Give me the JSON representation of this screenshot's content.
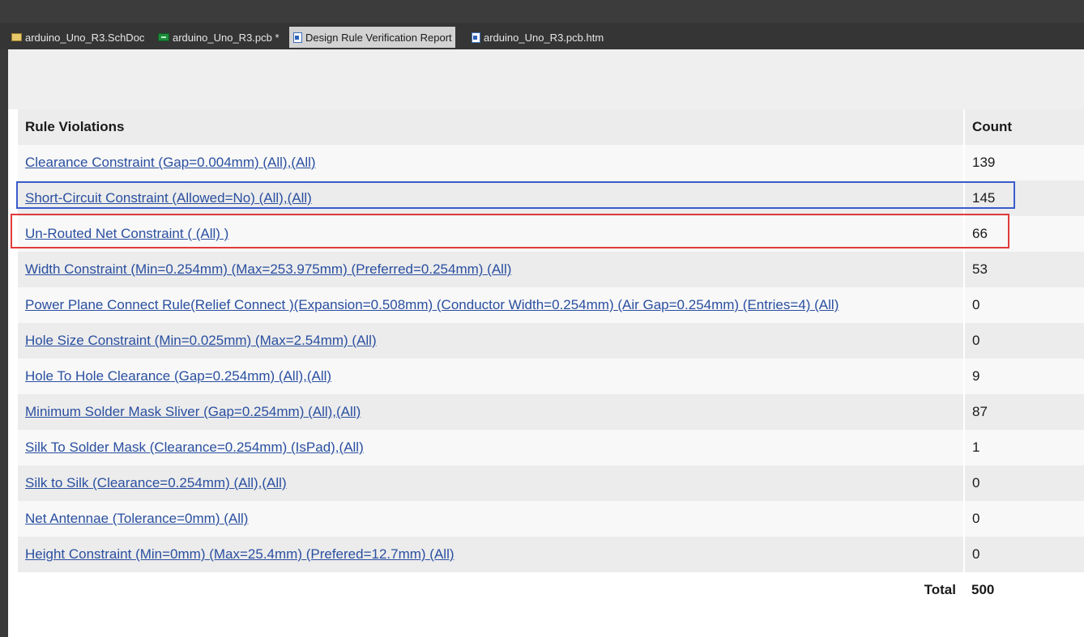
{
  "tabs": [
    {
      "label": "arduino_Uno_R3.SchDoc",
      "icon": "schematic-document-icon"
    },
    {
      "label": "arduino_Uno_R3.pcb *",
      "icon": "pcb-document-icon"
    },
    {
      "label": "Design Rule Verification Report",
      "icon": "report-document-icon"
    },
    {
      "label": "arduino_Uno_R3.pcb.htm",
      "icon": "html-document-icon"
    }
  ],
  "active_tab": "Design Rule Verification Report",
  "report": {
    "header_rule": "Rule Violations",
    "header_count": "Count",
    "rows": [
      {
        "rule": "Clearance Constraint (Gap=0.004mm) (All),(All)",
        "count": "139"
      },
      {
        "rule": "Short-Circuit Constraint (Allowed=No) (All),(All)",
        "count": "145"
      },
      {
        "rule": "Un-Routed Net Constraint ( (All) )",
        "count": "66"
      },
      {
        "rule": "Width Constraint (Min=0.254mm) (Max=253.975mm) (Preferred=0.254mm) (All)",
        "count": "53"
      },
      {
        "rule": "Power Plane Connect Rule(Relief Connect )(Expansion=0.508mm) (Conductor Width=0.254mm) (Air Gap=0.254mm) (Entries=4) (All)",
        "count": "0"
      },
      {
        "rule": "Hole Size Constraint (Min=0.025mm) (Max=2.54mm) (All)",
        "count": "0"
      },
      {
        "rule": "Hole To Hole Clearance (Gap=0.254mm) (All),(All)",
        "count": "9"
      },
      {
        "rule": "Minimum Solder Mask Sliver (Gap=0.254mm) (All),(All)",
        "count": "87"
      },
      {
        "rule": "Silk To Solder Mask (Clearance=0.254mm) (IsPad),(All)",
        "count": "1"
      },
      {
        "rule": "Silk to Silk (Clearance=0.254mm) (All),(All)",
        "count": "0"
      },
      {
        "rule": "Net Antennae (Tolerance=0mm) (All)",
        "count": "0"
      },
      {
        "rule": "Height Constraint (Min=0mm) (Max=25.4mm) (Prefered=12.7mm) (All)",
        "count": "0"
      }
    ],
    "total_label": "Total",
    "total_count": "500"
  },
  "colors": {
    "link": "#2a4fa0",
    "highlight_blue": "#3a5ccc",
    "highlight_red": "#e23a3a"
  }
}
